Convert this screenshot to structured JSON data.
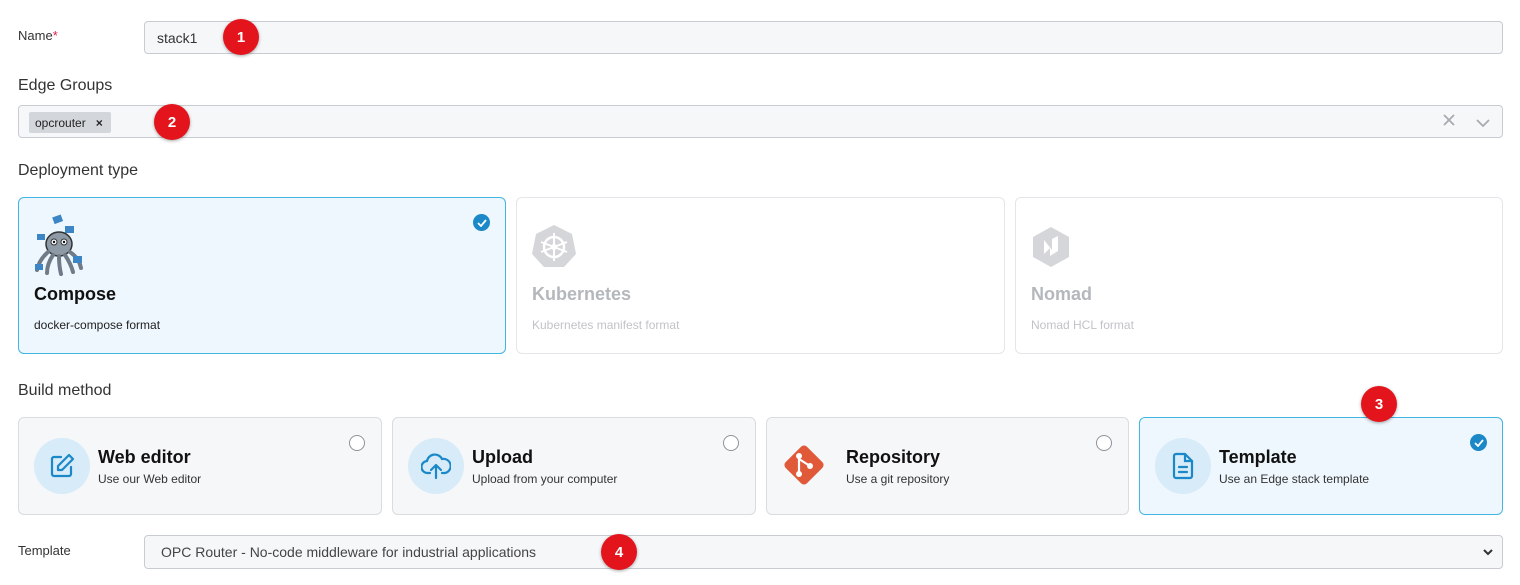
{
  "name_field": {
    "label": "Name",
    "required_mark": "*",
    "value": "stack1"
  },
  "edge_groups": {
    "label": "Edge Groups",
    "tags": [
      {
        "label": "opcrouter",
        "remove": "×"
      }
    ]
  },
  "deployment": {
    "label": "Deployment type",
    "options": [
      {
        "title": "Compose",
        "desc": "docker-compose format",
        "selected": true,
        "icon": "docker-compose-octopus-icon"
      },
      {
        "title": "Kubernetes",
        "desc": "Kubernetes manifest format",
        "selected": false,
        "disabled": true,
        "icon": "kubernetes-icon"
      },
      {
        "title": "Nomad",
        "desc": "Nomad HCL format",
        "selected": false,
        "disabled": true,
        "icon": "nomad-icon"
      }
    ]
  },
  "build_method": {
    "label": "Build method",
    "options": [
      {
        "title": "Web editor",
        "desc": "Use our Web editor",
        "selected": false,
        "icon": "edit-icon"
      },
      {
        "title": "Upload",
        "desc": "Upload from your computer",
        "selected": false,
        "icon": "cloud-upload-icon"
      },
      {
        "title": "Repository",
        "desc": "Use a git repository",
        "selected": false,
        "icon": "git-icon"
      },
      {
        "title": "Template",
        "desc": "Use an Edge stack template",
        "selected": true,
        "icon": "file-text-icon"
      }
    ]
  },
  "template_field": {
    "label": "Template",
    "value": "OPC Router - No-code middleware for industrial applications"
  },
  "annotations": [
    "1",
    "2",
    "3",
    "4"
  ],
  "colors": {
    "accent": "#1b88c8",
    "selected_bg": "#eef7fd",
    "selected_border": "#40b6e2",
    "badge": "#e3141c",
    "git": "#e05a3a"
  }
}
